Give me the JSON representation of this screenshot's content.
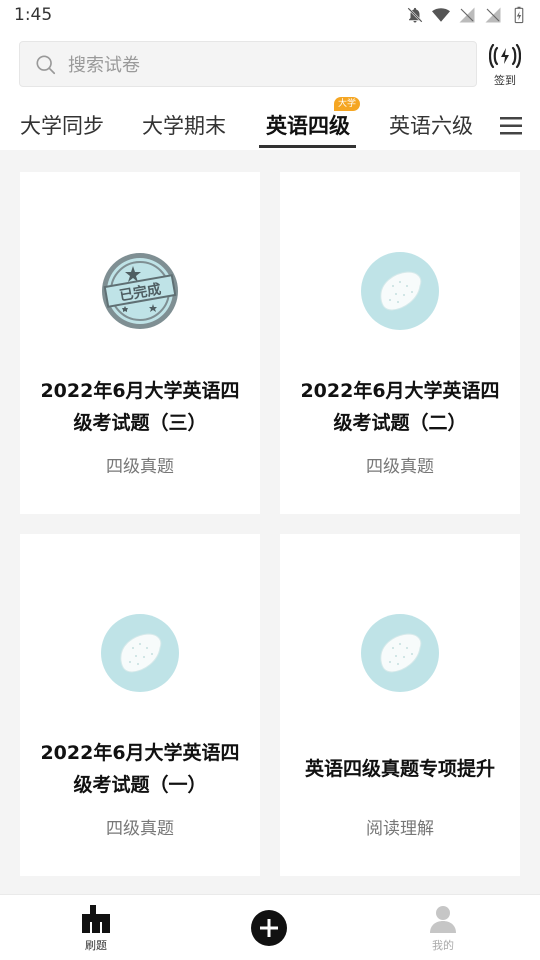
{
  "status": {
    "time": "1:45"
  },
  "search": {
    "placeholder": "搜索试卷"
  },
  "signin": {
    "label": "签到"
  },
  "tabs": [
    {
      "label": "大学同步"
    },
    {
      "label": "大学期末"
    },
    {
      "label": "英语四级",
      "badge": "大学"
    },
    {
      "label": "英语六级"
    }
  ],
  "cards": [
    {
      "title_line1": "2022年6月大学英语四",
      "title_line2": "级考试题（三）",
      "tag": "四级真题",
      "stamp": "已完成"
    },
    {
      "title_line1": "2022年6月大学英语四",
      "title_line2": "级考试题（二）",
      "tag": "四级真题"
    },
    {
      "title_line1": "2022年6月大学英语四",
      "title_line2": "级考试题（一）",
      "tag": "四级真题"
    },
    {
      "title_line1": "英语四级真题专项提升",
      "tag": "阅读理解"
    }
  ],
  "bottom_nav": [
    {
      "label": "刷题"
    },
    {
      "label": "我的"
    }
  ],
  "colors": {
    "accent_badge": "#f5a623",
    "icon_circle": "#bfe3e7"
  }
}
